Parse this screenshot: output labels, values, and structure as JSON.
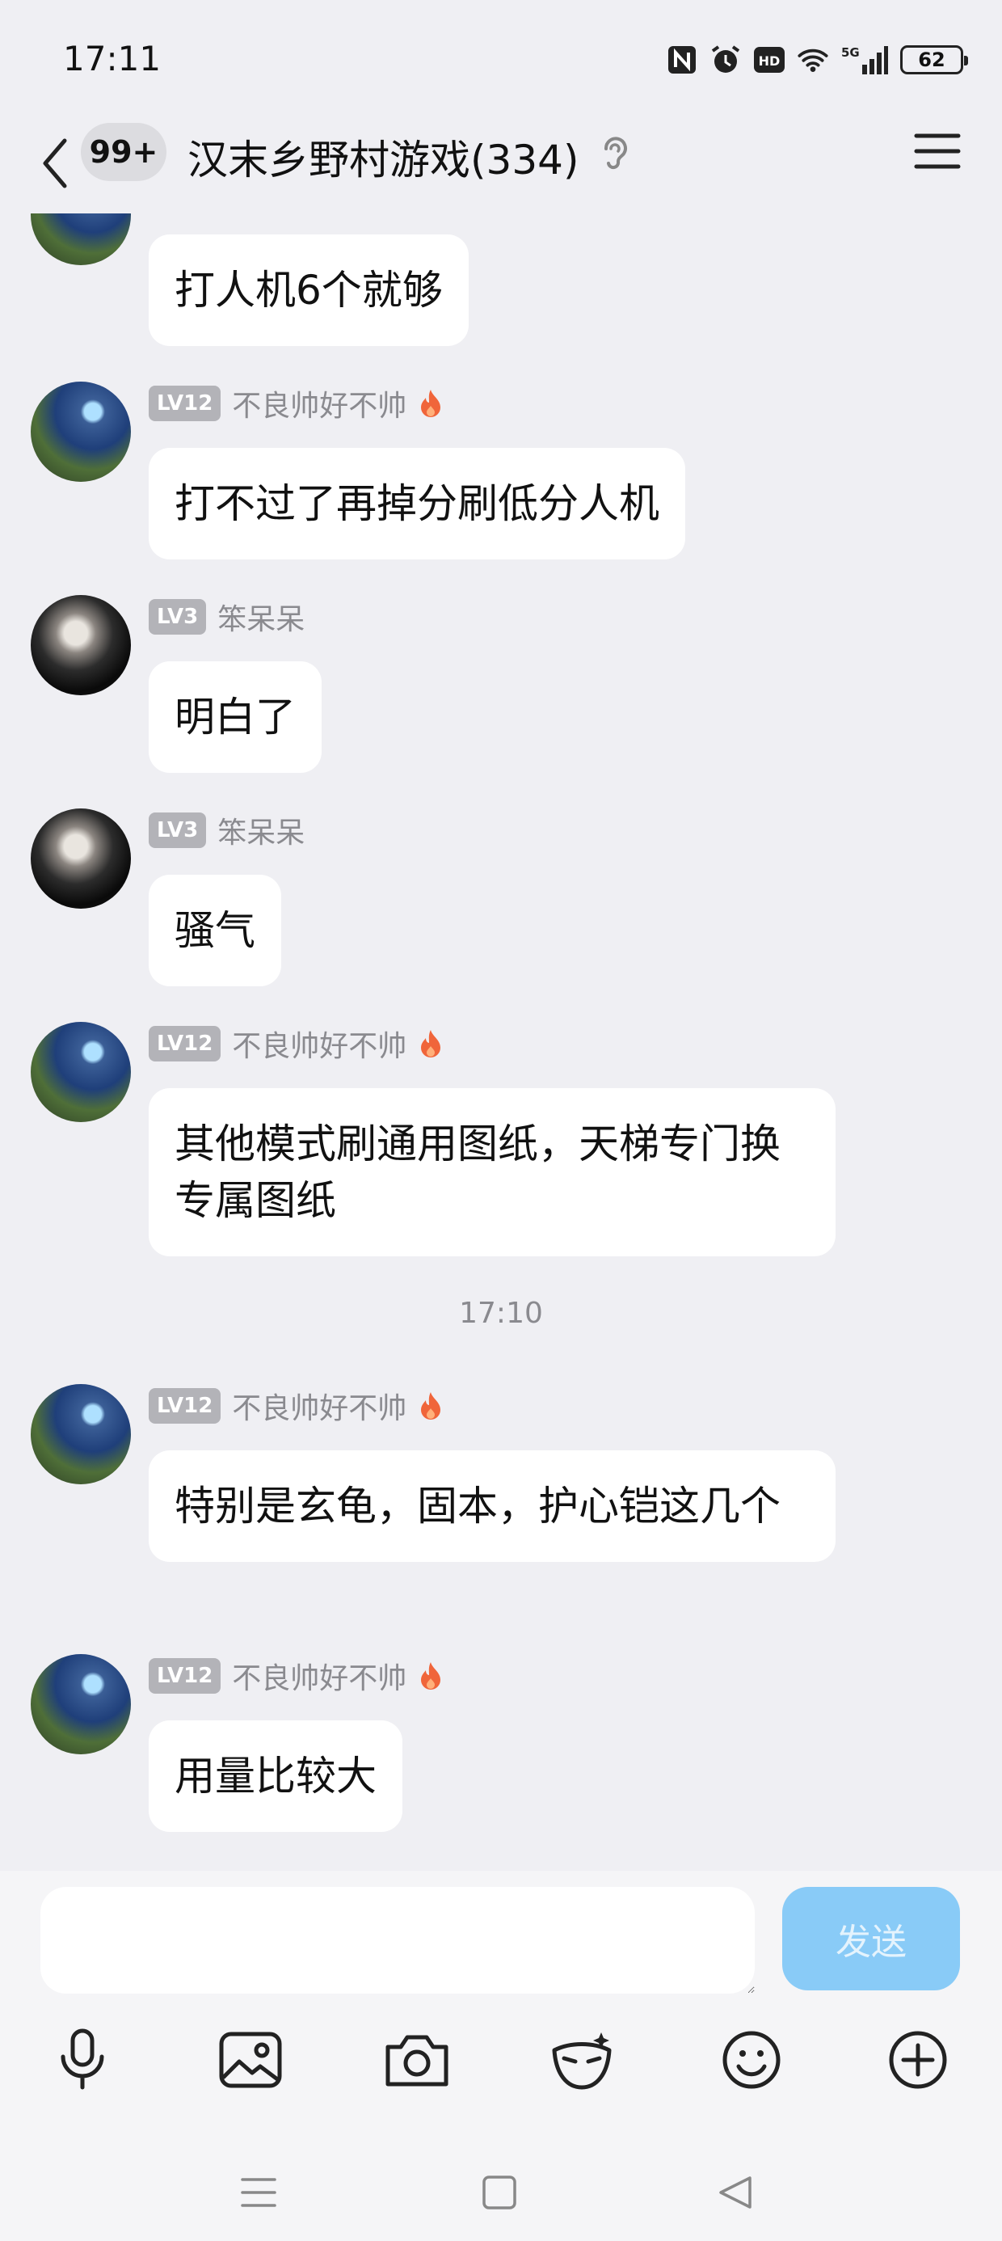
{
  "status_bar": {
    "time": "17:11",
    "battery": "62"
  },
  "header": {
    "unread_badge": "99+",
    "title": "汉末乡野村游戏(334)"
  },
  "messages": [
    {
      "text": "打人机6个就够"
    },
    {
      "level": "LV12",
      "name": "不良帅好不帅",
      "text": "打不过了再掉分刷低分人机"
    },
    {
      "level": "LV3",
      "name": "笨呆呆",
      "text": "明白了"
    },
    {
      "level": "LV3",
      "name": "笨呆呆",
      "text": "骚气"
    },
    {
      "level": "LV12",
      "name": "不良帅好不帅",
      "text": "其他模式刷通用图纸，天梯专门换专属图纸"
    },
    {
      "level": "LV12",
      "name": "不良帅好不帅",
      "text": "特别是玄龟，固本，护心铠这几个"
    },
    {
      "level": "LV12",
      "name": "不良帅好不帅",
      "text": "用量比较大"
    }
  ],
  "timestamp": "17:10",
  "composer": {
    "input_value": "",
    "send_label": "发送"
  },
  "toolbar_icons": [
    "microphone-icon",
    "image-icon",
    "camera-icon",
    "mask-icon",
    "emoji-icon",
    "plus-icon"
  ],
  "colors": {
    "background": "#efeff3",
    "bubble": "#ffffff",
    "send_button": "#89cbf7",
    "level_badge": "#b3b3b8"
  }
}
